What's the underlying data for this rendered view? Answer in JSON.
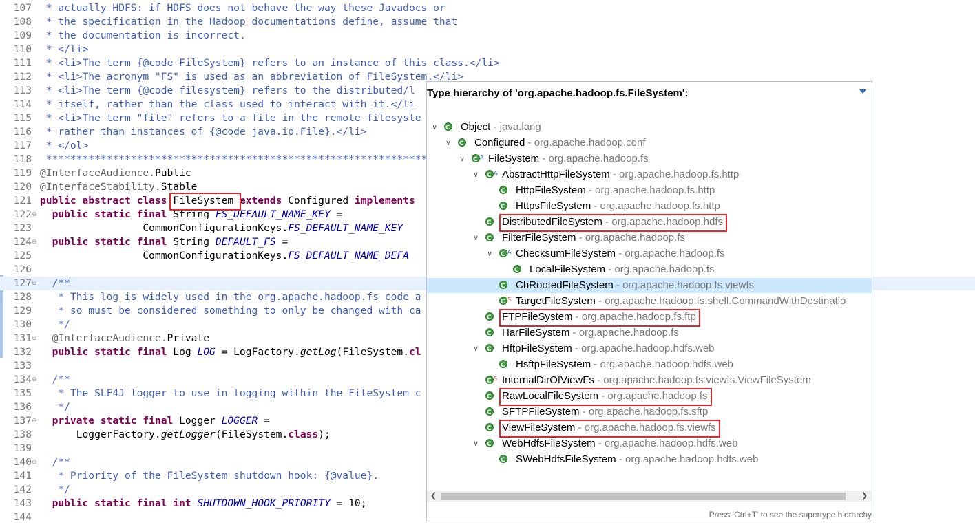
{
  "editor": {
    "lines": [
      {
        "n": "107",
        "fold": "",
        "segs": [
          [
            "cm",
            " * actually HDFS: if HDFS does not behave the way these Javadocs or"
          ]
        ]
      },
      {
        "n": "108",
        "fold": "",
        "segs": [
          [
            "cm",
            " * the specification in the Hadoop documentations define, assume that"
          ]
        ]
      },
      {
        "n": "109",
        "fold": "",
        "segs": [
          [
            "cm",
            " * the documentation is incorrect."
          ]
        ]
      },
      {
        "n": "110",
        "fold": "",
        "segs": [
          [
            "cm",
            " * </li>"
          ]
        ]
      },
      {
        "n": "111",
        "fold": "",
        "segs": [
          [
            "cm",
            " * <li>The term {@code FileSystem} refers to an instance of this class.</li>"
          ]
        ]
      },
      {
        "n": "112",
        "fold": "",
        "segs": [
          [
            "cm",
            " * <li>The acronym \"FS\" is used as an abbreviation of FileSystem.</li>"
          ]
        ]
      },
      {
        "n": "113",
        "fold": "",
        "segs": [
          [
            "cm",
            " * <li>The term {@code filesystem} refers to the distributed/l"
          ]
        ]
      },
      {
        "n": "114",
        "fold": "",
        "segs": [
          [
            "cm",
            " * itself, rather than the class used to interact with it.</li"
          ]
        ]
      },
      {
        "n": "115",
        "fold": "",
        "segs": [
          [
            "cm",
            " * <li>The term \"file\" refers to a file in the remote filesyste"
          ]
        ]
      },
      {
        "n": "116",
        "fold": "",
        "segs": [
          [
            "cm",
            " * rather than instances of {@code java.io.File}.</li>"
          ]
        ]
      },
      {
        "n": "117",
        "fold": "",
        "segs": [
          [
            "cm",
            " * </ol>"
          ]
        ]
      },
      {
        "n": "118",
        "fold": "",
        "segs": [
          [
            "cm",
            " **********************************************************************"
          ]
        ]
      },
      {
        "n": "119",
        "fold": "",
        "segs": [
          [
            "an",
            "@InterfaceAudience."
          ],
          [
            "",
            "Public"
          ]
        ]
      },
      {
        "n": "120",
        "fold": "",
        "segs": [
          [
            "an",
            "@InterfaceStability."
          ],
          [
            "",
            "Stable"
          ]
        ]
      },
      {
        "n": "121",
        "fold": "",
        "segs": [
          [
            "kw",
            "public abstract class"
          ],
          [
            "",
            " FileSystem "
          ],
          [
            "kw",
            "extends"
          ],
          [
            "",
            " Configured "
          ],
          [
            "kw",
            "implements"
          ]
        ]
      },
      {
        "n": "122",
        "fold": "⊖",
        "segs": [
          [
            "",
            "  "
          ],
          [
            "kw",
            "public static final"
          ],
          [
            "",
            " String "
          ],
          [
            "fi",
            "FS_DEFAULT_NAME_KEY"
          ],
          [
            "",
            " ="
          ]
        ]
      },
      {
        "n": "123",
        "fold": "",
        "segs": [
          [
            "",
            "                 CommonConfigurationKeys."
          ],
          [
            "fi",
            "FS_DEFAULT_NAME_KEY"
          ]
        ]
      },
      {
        "n": "124",
        "fold": "⊖",
        "segs": [
          [
            "",
            "  "
          ],
          [
            "kw",
            "public static final"
          ],
          [
            "",
            " String "
          ],
          [
            "fi",
            "DEFAULT_FS"
          ],
          [
            "",
            " ="
          ]
        ]
      },
      {
        "n": "125",
        "fold": "",
        "segs": [
          [
            "",
            "                 CommonConfigurationKeys."
          ],
          [
            "fi",
            "FS_DEFAULT_NAME_DEFA"
          ]
        ]
      },
      {
        "n": "126",
        "fold": "",
        "segs": [
          [
            "",
            ""
          ]
        ]
      },
      {
        "n": "127",
        "fold": "⊖",
        "segs": [
          [
            "cm",
            "  /**"
          ]
        ]
      },
      {
        "n": "128",
        "fold": "",
        "segs": [
          [
            "cm",
            "   * This log is widely used in the org.apache.hadoop.fs code a"
          ]
        ]
      },
      {
        "n": "129",
        "fold": "",
        "segs": [
          [
            "cm",
            "   * so must be considered something to only be changed with ca"
          ]
        ]
      },
      {
        "n": "130",
        "fold": "",
        "segs": [
          [
            "cm",
            "   */"
          ]
        ]
      },
      {
        "n": "131",
        "fold": "⊖",
        "segs": [
          [
            "an",
            "  @InterfaceAudience."
          ],
          [
            "",
            "Private"
          ]
        ]
      },
      {
        "n": "132",
        "fold": "",
        "segs": [
          [
            "",
            "  "
          ],
          [
            "kw",
            "public static final"
          ],
          [
            "",
            " Log "
          ],
          [
            "fi",
            "LOG"
          ],
          [
            "",
            " = LogFactory."
          ],
          [
            "it",
            "getLog"
          ],
          [
            "",
            "(FileSystem."
          ],
          [
            "kw",
            "cl"
          ]
        ]
      },
      {
        "n": "133",
        "fold": "",
        "segs": [
          [
            "",
            ""
          ]
        ]
      },
      {
        "n": "134",
        "fold": "⊖",
        "segs": [
          [
            "cm",
            "  /**"
          ]
        ]
      },
      {
        "n": "135",
        "fold": "",
        "segs": [
          [
            "cm",
            "   * The SLF4J logger to use in logging within the FileSystem c"
          ]
        ]
      },
      {
        "n": "136",
        "fold": "",
        "segs": [
          [
            "cm",
            "   */"
          ]
        ]
      },
      {
        "n": "137",
        "fold": "⊖",
        "segs": [
          [
            "",
            "  "
          ],
          [
            "kw",
            "private static final"
          ],
          [
            "",
            " Logger "
          ],
          [
            "fi",
            "LOGGER"
          ],
          [
            "",
            " ="
          ]
        ]
      },
      {
        "n": "138",
        "fold": "",
        "segs": [
          [
            "",
            "      LoggerFactory."
          ],
          [
            "it",
            "getLogger"
          ],
          [
            "",
            "(FileSystem."
          ],
          [
            "kw",
            "class"
          ],
          [
            "",
            ");"
          ]
        ]
      },
      {
        "n": "139",
        "fold": "",
        "segs": [
          [
            "",
            ""
          ]
        ]
      },
      {
        "n": "140",
        "fold": "⊖",
        "segs": [
          [
            "cm",
            "  /**"
          ]
        ]
      },
      {
        "n": "141",
        "fold": "",
        "segs": [
          [
            "cm",
            "   * Priority of the FileSystem shutdown hook: {@value}."
          ]
        ]
      },
      {
        "n": "142",
        "fold": "",
        "segs": [
          [
            "cm",
            "   */"
          ]
        ]
      },
      {
        "n": "143",
        "fold": "",
        "segs": [
          [
            "",
            "  "
          ],
          [
            "kw",
            "public static final int"
          ],
          [
            "",
            " "
          ],
          [
            "fi",
            "SHUTDOWN_HOOK_PRIORITY"
          ],
          [
            "",
            " = 10;"
          ]
        ]
      },
      {
        "n": "144",
        "fold": "",
        "segs": [
          [
            "",
            ""
          ]
        ]
      }
    ]
  },
  "hierarchy": {
    "title": "Type hierarchy of 'org.apache.hadoop.fs.FileSystem':",
    "footer": "Press 'Ctrl+T' to see the supertype hierarchy",
    "items": [
      {
        "depth": 0,
        "exp": true,
        "name": "Object",
        "pkg": "java.lang",
        "sup": "",
        "hl": false
      },
      {
        "depth": 1,
        "exp": true,
        "name": "Configured",
        "pkg": "org.apache.hadoop.conf",
        "sup": "",
        "hl": false
      },
      {
        "depth": 2,
        "exp": true,
        "name": "FileSystem",
        "pkg": "org.apache.hadoop.fs",
        "sup": "A",
        "hl": false
      },
      {
        "depth": 3,
        "exp": true,
        "name": "AbstractHttpFileSystem",
        "pkg": "org.apache.hadoop.fs.http",
        "sup": "A",
        "hl": false
      },
      {
        "depth": 4,
        "exp": false,
        "name": "HttpFileSystem",
        "pkg": "org.apache.hadoop.fs.http",
        "sup": "",
        "hl": false
      },
      {
        "depth": 4,
        "exp": false,
        "name": "HttpsFileSystem",
        "pkg": "org.apache.hadoop.fs.http",
        "sup": "",
        "hl": false
      },
      {
        "depth": 3,
        "exp": false,
        "name": "DistributedFileSystem",
        "pkg": "org.apache.hadoop.hdfs",
        "sup": "",
        "hl": true
      },
      {
        "depth": 3,
        "exp": true,
        "name": "FilterFileSystem",
        "pkg": "org.apache.hadoop.fs",
        "sup": "",
        "hl": false
      },
      {
        "depth": 4,
        "exp": true,
        "name": "ChecksumFileSystem",
        "pkg": "org.apache.hadoop.fs",
        "sup": "A",
        "hl": false
      },
      {
        "depth": 5,
        "exp": false,
        "name": "LocalFileSystem",
        "pkg": "org.apache.hadoop.fs",
        "sup": "",
        "hl": false
      },
      {
        "depth": 4,
        "exp": false,
        "name": "ChRootedFileSystem",
        "pkg": "org.apache.hadoop.fs.viewfs",
        "sup": "",
        "hl": false,
        "sel": true
      },
      {
        "depth": 4,
        "exp": false,
        "name": "TargetFileSystem",
        "pkg": "org.apache.hadoop.fs.shell.CommandWithDestinatio",
        "sup": "S",
        "hl": false
      },
      {
        "depth": 3,
        "exp": false,
        "name": "FTPFileSystem",
        "pkg": "org.apache.hadoop.fs.ftp",
        "sup": "",
        "hl": true
      },
      {
        "depth": 3,
        "exp": false,
        "name": "HarFileSystem",
        "pkg": "org.apache.hadoop.fs",
        "sup": "",
        "hl": false
      },
      {
        "depth": 3,
        "exp": true,
        "name": "HftpFileSystem",
        "pkg": "org.apache.hadoop.hdfs.web",
        "sup": "",
        "hl": false
      },
      {
        "depth": 4,
        "exp": false,
        "name": "HsftpFileSystem",
        "pkg": "org.apache.hadoop.hdfs.web",
        "sup": "",
        "hl": false
      },
      {
        "depth": 3,
        "exp": false,
        "name": "InternalDirOfViewFs",
        "pkg": "org.apache.hadoop.fs.viewfs.ViewFileSystem",
        "sup": "S",
        "hl": false
      },
      {
        "depth": 3,
        "exp": false,
        "name": "RawLocalFileSystem",
        "pkg": "org.apache.hadoop.fs",
        "sup": "",
        "hl": true
      },
      {
        "depth": 3,
        "exp": false,
        "name": "SFTPFileSystem",
        "pkg": "org.apache.hadoop.fs.sftp",
        "sup": "",
        "hl": false
      },
      {
        "depth": 3,
        "exp": false,
        "name": "ViewFileSystem",
        "pkg": "org.apache.hadoop.fs.viewfs",
        "sup": "",
        "hl": true
      },
      {
        "depth": 3,
        "exp": true,
        "name": "WebHdfsFileSystem",
        "pkg": "org.apache.hadoop.hdfs.web",
        "sup": "",
        "hl": false
      },
      {
        "depth": 4,
        "exp": false,
        "name": "SWebHdfsFileSystem",
        "pkg": "org.apache.hadoop.hdfs.web",
        "sup": "",
        "hl": false
      }
    ]
  }
}
